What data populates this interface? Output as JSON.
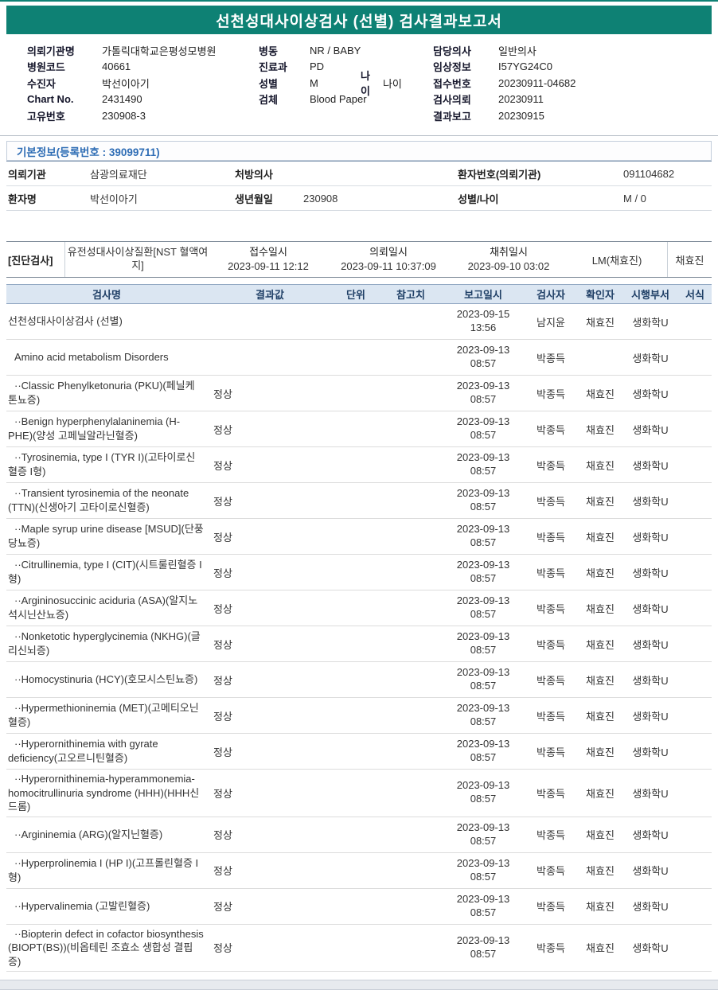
{
  "report": {
    "title": "선천성대사이상검사 (선별) 검사결과보고서"
  },
  "colors": {
    "accent_teal": "#0e8174",
    "table_header_bg": "#dbe6f2",
    "section_title_blue": "#2f6db5"
  },
  "patient_info": {
    "left": [
      {
        "label": "의뢰기관명",
        "value": "가톨릭대학교은평성모병원"
      },
      {
        "label": "병원코드",
        "value": "40661"
      },
      {
        "label": "수진자",
        "value": "박선이아기"
      },
      {
        "label": "Chart No.",
        "value": "2431490"
      },
      {
        "label": "고유번호",
        "value": "230908-3"
      }
    ],
    "middle": [
      {
        "label": "병동",
        "value": "NR / BABY"
      },
      {
        "label": "진료과",
        "value": "PD"
      },
      {
        "label": "성별",
        "value": "M",
        "label2": "나이",
        "value2": "나이"
      },
      {
        "label": "검체",
        "value": "Blood Paper"
      }
    ],
    "right": [
      {
        "label": "담당의사",
        "value": "일반의사"
      },
      {
        "label": "임상정보",
        "value": "I57YG24C0"
      },
      {
        "label": "접수번호",
        "value": "20230911-04682"
      },
      {
        "label": "검사의뢰",
        "value": "20230911"
      },
      {
        "label": "결과보고",
        "value": "20230915"
      }
    ]
  },
  "basic_info": {
    "section_title": "기본정보(등록번호 : 39099711)",
    "rows": [
      [
        {
          "label": "의뢰기관",
          "value": "삼광의료재단"
        },
        {
          "label": "처방의사",
          "value": ""
        },
        {
          "label": "환자번호(의뢰기관)",
          "value": "091104682"
        }
      ],
      [
        {
          "label": "환자명",
          "value": "박선이아기"
        },
        {
          "label": "생년월일",
          "value": "230908"
        },
        {
          "label": "성별/나이",
          "value": "M / 0"
        }
      ]
    ]
  },
  "diagnosis": {
    "tag": "[진단검사]",
    "test_name": "유전성대사이상질환[NST 혈액여지]",
    "receipt_label": "접수일시",
    "receipt_value": "2023-09-11 12:12",
    "request_label": "의뢰일시",
    "request_value": "2023-09-11 10:37:09",
    "collect_label": "채취일시",
    "collect_value": "2023-09-10 03:02",
    "lm": "LM(채효진)",
    "collector": "채효진"
  },
  "results_table": {
    "headers": [
      "검사명",
      "결과값",
      "단위",
      "참고치",
      "보고일시",
      "검사자",
      "확인자",
      "시행부서",
      "서식"
    ],
    "rows": [
      {
        "name": "선천성대사이상검사 (선별)",
        "result": "",
        "unit": "",
        "ref": "",
        "report_date": "2023-09-15",
        "report_time": "13:56",
        "tester": "남지윤",
        "confirmer": "채효진",
        "dept": "생화학U",
        "format": ""
      },
      {
        "name": "Amino acid metabolism Disorders",
        "result": "",
        "unit": "",
        "ref": "",
        "report_date": "2023-09-13",
        "report_time": "08:57",
        "tester": "박종득",
        "confirmer": "",
        "dept": "생화학U",
        "format": ""
      },
      {
        "name": "··Classic Phenylketonuria (PKU)(페닐케톤뇨증)",
        "result": "정상",
        "unit": "",
        "ref": "",
        "report_date": "2023-09-13",
        "report_time": "08:57",
        "tester": "박종득",
        "confirmer": "채효진",
        "dept": "생화학U",
        "format": ""
      },
      {
        "name": "··Benign hyperphenylalaninemia (H-PHE)(양성 고페닐알라닌혈증)",
        "result": "정상",
        "unit": "",
        "ref": "",
        "report_date": "2023-09-13",
        "report_time": "08:57",
        "tester": "박종득",
        "confirmer": "채효진",
        "dept": "생화학U",
        "format": ""
      },
      {
        "name": "··Tyrosinemia, type I (TYR I)(고타이로신혈증 I형)",
        "result": "정상",
        "unit": "",
        "ref": "",
        "report_date": "2023-09-13",
        "report_time": "08:57",
        "tester": "박종득",
        "confirmer": "채효진",
        "dept": "생화학U",
        "format": ""
      },
      {
        "name": "··Transient tyrosinemia of the neonate (TTN)(신생아기 고타이로신혈증)",
        "result": "정상",
        "unit": "",
        "ref": "",
        "report_date": "2023-09-13",
        "report_time": "08:57",
        "tester": "박종득",
        "confirmer": "채효진",
        "dept": "생화학U",
        "format": ""
      },
      {
        "name": "··Maple syrup urine disease [MSUD](단풍당뇨증)",
        "result": "정상",
        "unit": "",
        "ref": "",
        "report_date": "2023-09-13",
        "report_time": "08:57",
        "tester": "박종득",
        "confirmer": "채효진",
        "dept": "생화학U",
        "format": ""
      },
      {
        "name": "··Citrullinemia, type I (CIT)(시트룰린혈증 I형)",
        "result": "정상",
        "unit": "",
        "ref": "",
        "report_date": "2023-09-13",
        "report_time": "08:57",
        "tester": "박종득",
        "confirmer": "채효진",
        "dept": "생화학U",
        "format": ""
      },
      {
        "name": "··Argininosuccinic aciduria (ASA)(알지노석시닌산뇨증)",
        "result": "정상",
        "unit": "",
        "ref": "",
        "report_date": "2023-09-13",
        "report_time": "08:57",
        "tester": "박종득",
        "confirmer": "채효진",
        "dept": "생화학U",
        "format": ""
      },
      {
        "name": "··Nonketotic hyperglycinemia (NKHG)(글리신뇌증)",
        "result": "정상",
        "unit": "",
        "ref": "",
        "report_date": "2023-09-13",
        "report_time": "08:57",
        "tester": "박종득",
        "confirmer": "채효진",
        "dept": "생화학U",
        "format": ""
      },
      {
        "name": "··Homocystinuria (HCY)(호모시스틴뇨증)",
        "result": "정상",
        "unit": "",
        "ref": "",
        "report_date": "2023-09-13",
        "report_time": "08:57",
        "tester": "박종득",
        "confirmer": "채효진",
        "dept": "생화학U",
        "format": ""
      },
      {
        "name": "··Hypermethioninemia (MET)(고메티오닌혈증)",
        "result": "정상",
        "unit": "",
        "ref": "",
        "report_date": "2023-09-13",
        "report_time": "08:57",
        "tester": "박종득",
        "confirmer": "채효진",
        "dept": "생화학U",
        "format": ""
      },
      {
        "name": "··Hyperornithinemia with gyrate deficiency(고오르니틴혈증)",
        "result": "정상",
        "unit": "",
        "ref": "",
        "report_date": "2023-09-13",
        "report_time": "08:57",
        "tester": "박종득",
        "confirmer": "채효진",
        "dept": "생화학U",
        "format": ""
      },
      {
        "name": "··Hyperornithinemia-hyperammonemia-homocitrullinuria syndrome (HHH)(HHH신드롬)",
        "result": "정상",
        "unit": "",
        "ref": "",
        "report_date": "2023-09-13",
        "report_time": "08:57",
        "tester": "박종득",
        "confirmer": "채효진",
        "dept": "생화학U",
        "format": ""
      },
      {
        "name": "··Argininemia (ARG)(알지닌혈증)",
        "result": "정상",
        "unit": "",
        "ref": "",
        "report_date": "2023-09-13",
        "report_time": "08:57",
        "tester": "박종득",
        "confirmer": "채효진",
        "dept": "생화학U",
        "format": ""
      },
      {
        "name": "··Hyperprolinemia I (HP I)(고프롤린혈증 I형)",
        "result": "정상",
        "unit": "",
        "ref": "",
        "report_date": "2023-09-13",
        "report_time": "08:57",
        "tester": "박종득",
        "confirmer": "채효진",
        "dept": "생화학U",
        "format": ""
      },
      {
        "name": "··Hypervalinemia (고발린혈증)",
        "result": "정상",
        "unit": "",
        "ref": "",
        "report_date": "2023-09-13",
        "report_time": "08:57",
        "tester": "박종득",
        "confirmer": "채효진",
        "dept": "생화학U",
        "format": ""
      },
      {
        "name": "··Biopterin defect in cofactor biosynthesis (BIOPT(BS))(비옵테린 조효소 생합성 결핍증)",
        "result": "정상",
        "unit": "",
        "ref": "",
        "report_date": "2023-09-13",
        "report_time": "08:57",
        "tester": "박종득",
        "confirmer": "채효진",
        "dept": "생화학U",
        "format": ""
      }
    ]
  }
}
